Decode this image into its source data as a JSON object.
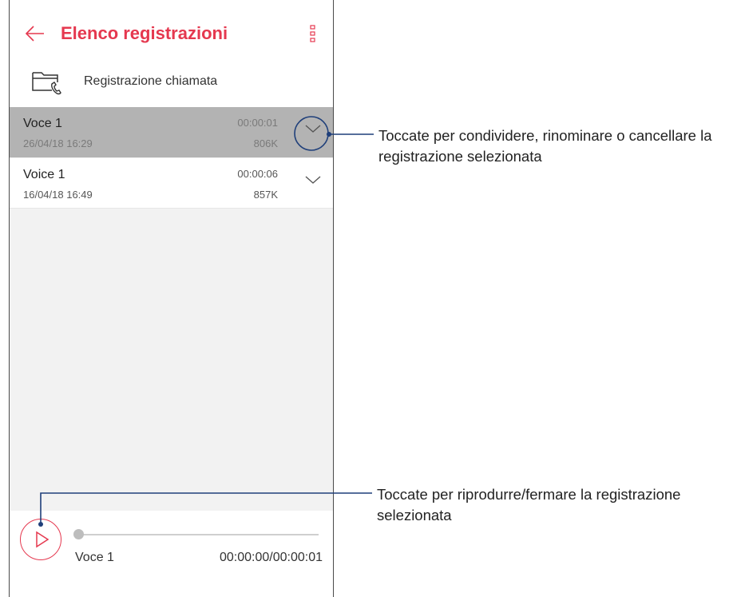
{
  "appbar": {
    "title": "Elenco registrazioni",
    "back_icon": "arrow-left-icon",
    "menu_icon": "more-vert-icon"
  },
  "folder": {
    "label": "Registrazione chiamata",
    "icon": "call-recording-folder-icon"
  },
  "recordings": [
    {
      "name": "Voce 1",
      "date": "26/04/18 16:29",
      "duration": "00:00:01",
      "size": "806K",
      "selected": true
    },
    {
      "name": "Voice 1",
      "date": "16/04/18 16:49",
      "duration": "00:00:06",
      "size": "857K",
      "selected": false
    }
  ],
  "player": {
    "name": "Voce 1",
    "time": "00:00:00/00:00:01",
    "progress": 0,
    "play_icon": "play-icon"
  },
  "annotations": {
    "expand": [
      "Toccate per condividere, rinominare o cancellare la",
      "registrazione selezionata"
    ],
    "play": [
      "Toccate per riprodurre/fermare la registrazione",
      "selezionata"
    ]
  },
  "colors": {
    "accent": "#e5384f",
    "selected_row": "#b3b3b3",
    "callout": "#1f3f7a",
    "list_bg": "#f2f2f2"
  }
}
